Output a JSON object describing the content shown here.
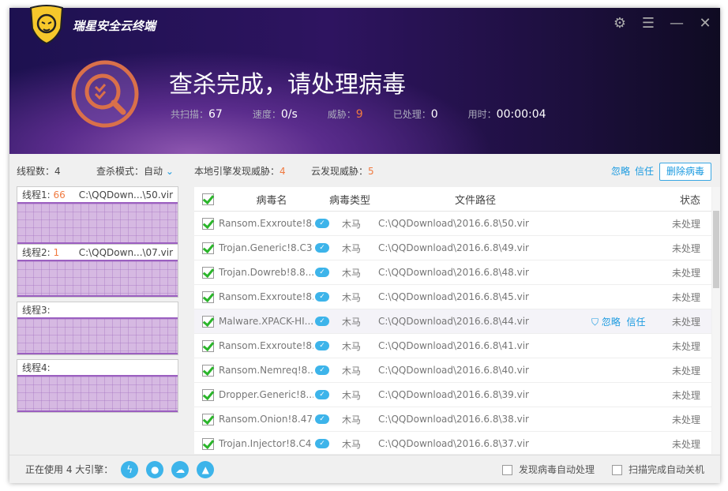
{
  "app": {
    "brand": "瑞星安全云终端"
  },
  "header": {
    "title": "查杀完成，请处理病毒",
    "stats": [
      {
        "label": "共扫描：",
        "value": "67"
      },
      {
        "label": "速度：",
        "value": "0/s"
      },
      {
        "label": "威胁：",
        "value": "9"
      },
      {
        "label": "已处理：",
        "value": "0"
      },
      {
        "label": "用时：",
        "value": "00:00:04"
      }
    ]
  },
  "left": {
    "threads_label": "线程数：",
    "threads": "4",
    "mode_label": "查杀模式：",
    "mode": "自动",
    "threads_list": [
      {
        "label": "线程1:",
        "count": "66",
        "path": "C:\\QQDown...\\50.vir"
      },
      {
        "label": "线程2:",
        "count": "1",
        "path": "C:\\QQDown...\\07.vir"
      },
      {
        "label": "线程3:",
        "count": "",
        "path": ""
      },
      {
        "label": "线程4:",
        "count": "",
        "path": ""
      }
    ]
  },
  "summary": {
    "local_label": "本地引擎发现威胁：",
    "local": "4",
    "cloud_label": "云发现威胁：",
    "cloud": "5",
    "ignore": "忽略",
    "trust": "信任",
    "delete": "删除病毒"
  },
  "table": {
    "headers": {
      "name": "病毒名",
      "type": "病毒类型",
      "path": "文件路径",
      "status": "状态"
    },
    "rows": [
      {
        "name": "Ransom.Exxroute!8...",
        "type": "木马",
        "path": "C:\\QQDownload\\2016.6.8\\50.vir",
        "status": "未处理"
      },
      {
        "name": "Trojan.Generic!8.C3",
        "type": "木马",
        "path": "C:\\QQDownload\\2016.6.8\\49.vir",
        "status": "未处理"
      },
      {
        "name": "Trojan.Dowreb!8.8...",
        "type": "木马",
        "path": "C:\\QQDownload\\2016.6.8\\48.vir",
        "status": "未处理"
      },
      {
        "name": "Ransom.Exxroute!8...",
        "type": "木马",
        "path": "C:\\QQDownload\\2016.6.8\\45.vir",
        "status": "未处理"
      },
      {
        "name": "Malware.XPACK-HI...",
        "type": "木马",
        "path": "C:\\QQDownload\\2016.6.8\\44.vir",
        "status": "未处理",
        "ignore": "忽略",
        "trust": "信任"
      },
      {
        "name": "Ransom.Exxroute!8...",
        "type": "木马",
        "path": "C:\\QQDownload\\2016.6.8\\41.vir",
        "status": "未处理"
      },
      {
        "name": "Ransom.Nemreq!8...",
        "type": "木马",
        "path": "C:\\QQDownload\\2016.6.8\\40.vir",
        "status": "未处理"
      },
      {
        "name": "Dropper.Generic!8....",
        "type": "木马",
        "path": "C:\\QQDownload\\2016.6.8\\39.vir",
        "status": "未处理"
      },
      {
        "name": "Ransom.Onion!8.478",
        "type": "木马",
        "path": "C:\\QQDownload\\2016.6.8\\38.vir",
        "status": "未处理"
      },
      {
        "name": "Trojan.Injector!8.C4",
        "type": "木马",
        "path": "C:\\QQDownload\\2016.6.8\\37.vir",
        "status": "未处理"
      }
    ]
  },
  "footer": {
    "engines": "正在使用 4 大引擎：",
    "auto_handle": "发现病毒自动处理",
    "auto_shutdown": "扫描完成自动关机"
  }
}
